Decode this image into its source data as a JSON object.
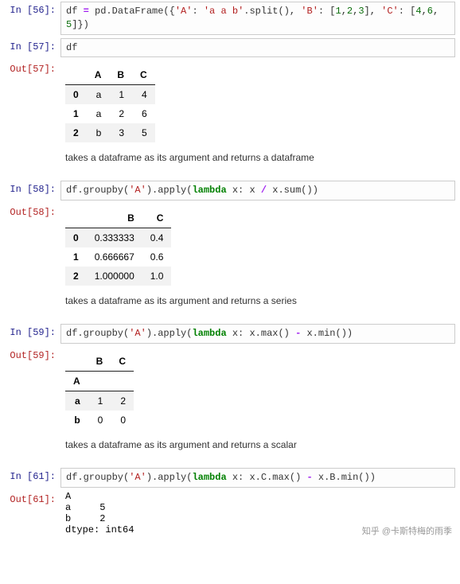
{
  "cells": [
    {
      "in_prompt": "In  [56]:",
      "code_tokens": [
        {
          "t": "df ",
          "c": "s-plain"
        },
        {
          "t": "=",
          "c": "s-op"
        },
        {
          "t": " pd.DataFrame({",
          "c": "s-plain"
        },
        {
          "t": "'A'",
          "c": "s-str"
        },
        {
          "t": ": ",
          "c": "s-plain"
        },
        {
          "t": "'a a b'",
          "c": "s-str"
        },
        {
          "t": ".split(), ",
          "c": "s-plain"
        },
        {
          "t": "'B'",
          "c": "s-str"
        },
        {
          "t": ": [",
          "c": "s-plain"
        },
        {
          "t": "1",
          "c": "s-num"
        },
        {
          "t": ",",
          "c": "s-plain"
        },
        {
          "t": "2",
          "c": "s-num"
        },
        {
          "t": ",",
          "c": "s-plain"
        },
        {
          "t": "3",
          "c": "s-num"
        },
        {
          "t": "], ",
          "c": "s-plain"
        },
        {
          "t": "'C'",
          "c": "s-str"
        },
        {
          "t": ": [",
          "c": "s-plain"
        },
        {
          "t": "4",
          "c": "s-num"
        },
        {
          "t": ",",
          "c": "s-plain"
        },
        {
          "t": "6",
          "c": "s-num"
        },
        {
          "t": ", ",
          "c": "s-plain"
        },
        {
          "t": "5",
          "c": "s-num"
        },
        {
          "t": "]})",
          "c": "s-plain"
        }
      ]
    },
    {
      "in_prompt": "In  [57]:",
      "code_tokens": [
        {
          "t": "df",
          "c": "s-plain"
        }
      ],
      "out_prompt": "Out[57]:",
      "table": {
        "columns": [
          "",
          "A",
          "B",
          "C"
        ],
        "index_name": null,
        "rows": [
          [
            "0",
            "a",
            "1",
            "4"
          ],
          [
            "1",
            "a",
            "2",
            "6"
          ],
          [
            "2",
            "b",
            "3",
            "5"
          ]
        ]
      },
      "desc": "takes a dataframe as its argument and returns a dataframe"
    },
    {
      "in_prompt": "In  [58]:",
      "code_tokens": [
        {
          "t": "df.groupby(",
          "c": "s-plain"
        },
        {
          "t": "'A'",
          "c": "s-str"
        },
        {
          "t": ").apply(",
          "c": "s-plain"
        },
        {
          "t": "lambda",
          "c": "s-kw"
        },
        {
          "t": " x: x ",
          "c": "s-plain"
        },
        {
          "t": "/",
          "c": "s-op"
        },
        {
          "t": " x.sum())",
          "c": "s-plain"
        }
      ],
      "out_prompt": "Out[58]:",
      "table": {
        "columns": [
          "",
          "B",
          "C"
        ],
        "index_name": null,
        "rows": [
          [
            "0",
            "0.333333",
            "0.4"
          ],
          [
            "1",
            "0.666667",
            "0.6"
          ],
          [
            "2",
            "1.000000",
            "1.0"
          ]
        ]
      },
      "desc": "takes a dataframe as its argument and returns a series"
    },
    {
      "in_prompt": "In  [59]:",
      "code_tokens": [
        {
          "t": "df.groupby(",
          "c": "s-plain"
        },
        {
          "t": "'A'",
          "c": "s-str"
        },
        {
          "t": ").apply(",
          "c": "s-plain"
        },
        {
          "t": "lambda",
          "c": "s-kw"
        },
        {
          "t": " x: x.max() ",
          "c": "s-plain"
        },
        {
          "t": "-",
          "c": "s-op"
        },
        {
          "t": " x.min())",
          "c": "s-plain"
        }
      ],
      "out_prompt": "Out[59]:",
      "table": {
        "columns": [
          "",
          "B",
          "C"
        ],
        "index_name": "A",
        "rows": [
          [
            "a",
            "1",
            "2"
          ],
          [
            "b",
            "0",
            "0"
          ]
        ]
      },
      "desc": "takes a dataframe as its argument and returns a scalar"
    },
    {
      "in_prompt": "In  [61]:",
      "code_tokens": [
        {
          "t": "df.groupby(",
          "c": "s-plain"
        },
        {
          "t": "'A'",
          "c": "s-str"
        },
        {
          "t": ").apply(",
          "c": "s-plain"
        },
        {
          "t": "lambda",
          "c": "s-kw"
        },
        {
          "t": " x: x.C.max() ",
          "c": "s-plain"
        },
        {
          "t": "-",
          "c": "s-op"
        },
        {
          "t": " x.B.min())",
          "c": "s-plain"
        }
      ],
      "out_prompt": "Out[61]:",
      "text_output": "A\na     5\nb     2\ndtype: int64"
    }
  ],
  "watermark": "知乎 @卡斯特梅的雨季"
}
